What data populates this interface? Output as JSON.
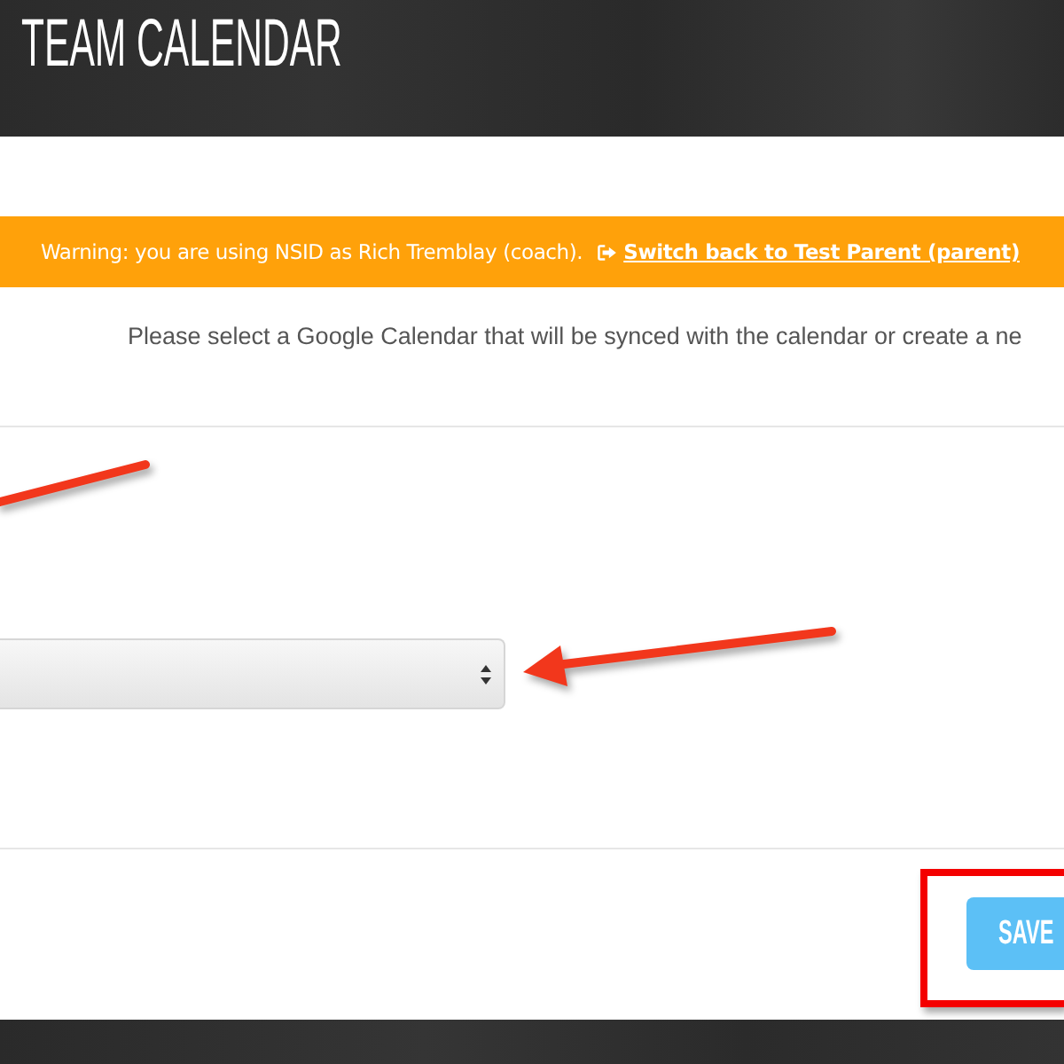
{
  "header": {
    "title": "TEAM CALENDAR"
  },
  "warning_banner": {
    "message": "Warning: you are using NSID as Rich Tremblay (coach).",
    "link": "Switch back to Test Parent (parent)"
  },
  "instructions": "Please select a Google Calendar that will be synced with the calendar or create a ne",
  "save_button": {
    "label": "SAVE"
  }
}
